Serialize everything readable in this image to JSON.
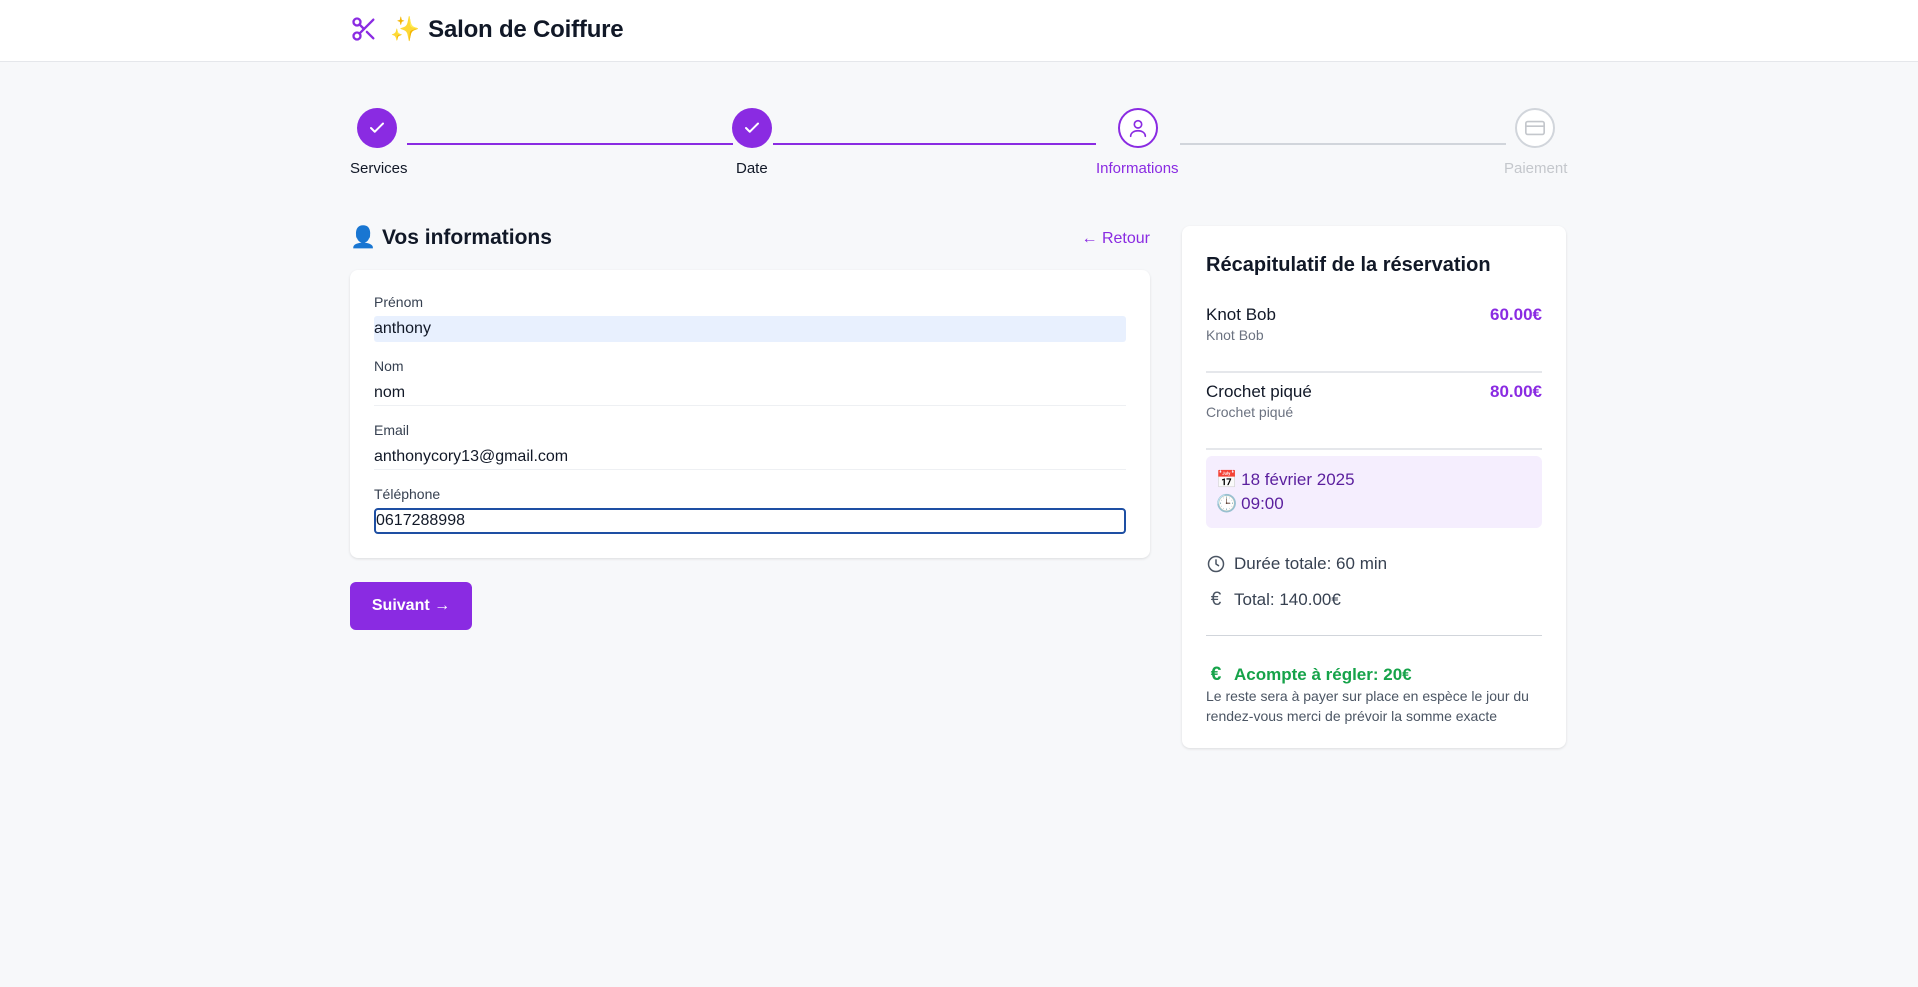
{
  "header": {
    "title": "Salon de Coiffure",
    "sparkle": "✨",
    "logo_icon": "scissors-icon"
  },
  "stepper": {
    "steps": [
      {
        "label": "Services",
        "state": "done",
        "icon": "check-icon"
      },
      {
        "label": "Date",
        "state": "done",
        "icon": "check-icon"
      },
      {
        "label": "Informations",
        "state": "active",
        "icon": "user-icon"
      },
      {
        "label": "Paiement",
        "state": "todo",
        "icon": "credit-card-icon"
      }
    ]
  },
  "form": {
    "title": "👤 Vos informations",
    "back_label": "← Retour",
    "fields": {
      "first_name": {
        "label": "Prénom",
        "value": "anthony"
      },
      "last_name": {
        "label": "Nom",
        "value": "nom"
      },
      "email": {
        "label": "Email",
        "value": "anthonycory13@gmail.com"
      },
      "phone": {
        "label": "Téléphone",
        "value": "0617288998"
      }
    },
    "next_label": "Suivant →"
  },
  "summary": {
    "title": "Récapitulatif de la réservation",
    "services": [
      {
        "name": "Knot Bob",
        "sub": "Knot Bob",
        "price": "60.00€"
      },
      {
        "name": "Crochet piqué",
        "sub": "Crochet piqué",
        "price": "80.00€"
      }
    ],
    "date_emoji": "📅",
    "date": "18 février 2025",
    "time_emoji": "🕒",
    "time": "09:00",
    "duration": "Durée totale: 60 min",
    "total": "Total: 140.00€",
    "deposit": "Acompte à régler: 20€",
    "deposit_note": "Le reste sera à payer sur place en espèce le jour du rendez-vous merci de prévoir la somme exacte"
  },
  "colors": {
    "accent": "#8a2be2",
    "success": "#16a34a",
    "focus": "#1e4fa3"
  }
}
